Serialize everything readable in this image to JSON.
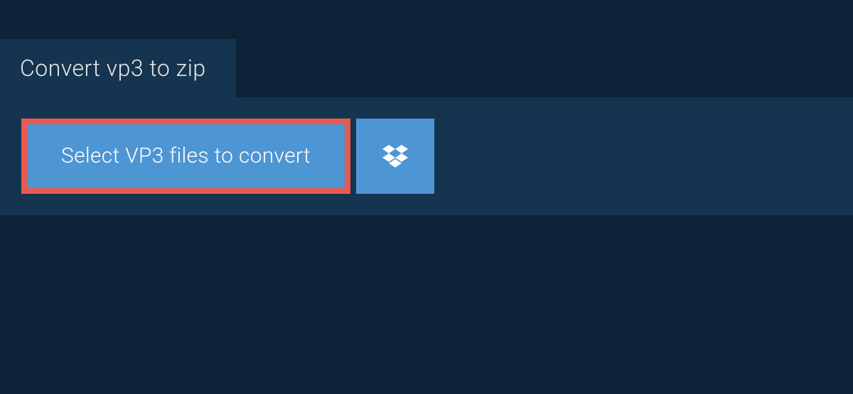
{
  "tab": {
    "title": "Convert vp3 to zip"
  },
  "actions": {
    "select_button_label": "Select VP3 files to convert",
    "cloud_provider": "dropbox"
  },
  "colors": {
    "background": "#0d2438",
    "panel": "#153450",
    "button": "#4e95d3",
    "highlight_border": "#e85a4f",
    "text_light": "#ffffff"
  }
}
